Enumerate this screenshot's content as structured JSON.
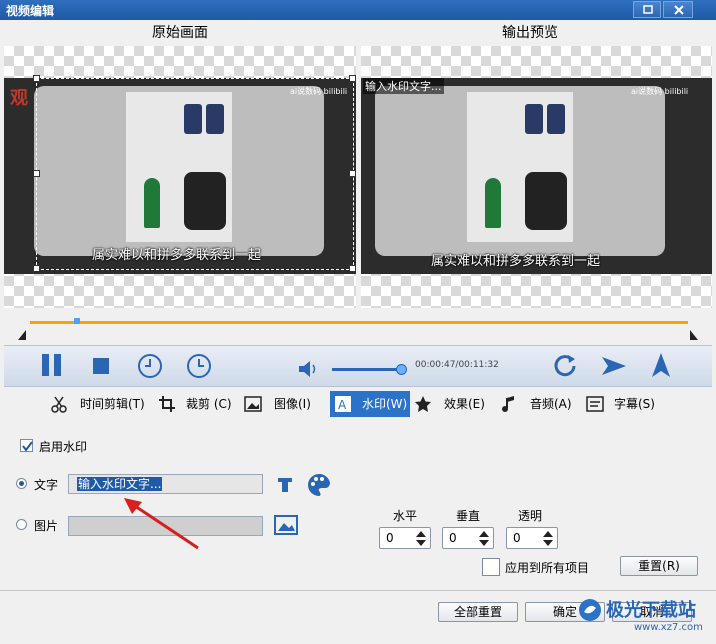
{
  "window": {
    "title": "视频编辑"
  },
  "panes": {
    "original_label": "原始画面",
    "preview_label": "输出预览"
  },
  "video": {
    "subtitle": "属实难以和拼多多联系到一起",
    "watermark_text": "输入水印文字...",
    "channel_logo": "ai说数码 bilibili",
    "corner_mark": "观"
  },
  "player": {
    "timecode": "00:00:47/00:11:32"
  },
  "tabs": [
    {
      "label": "时间剪辑(T)",
      "icon": "scissors-icon"
    },
    {
      "label": "裁剪 (C)",
      "icon": "crop-icon"
    },
    {
      "label": "图像(I)",
      "icon": "image-icon"
    },
    {
      "label": "水印(W)",
      "icon": "watermark-icon"
    },
    {
      "label": "效果(E)",
      "icon": "star-icon"
    },
    {
      "label": "音频(A)",
      "icon": "music-note-icon"
    },
    {
      "label": "字幕(S)",
      "icon": "subtitle-icon"
    }
  ],
  "watermark": {
    "enable_label": "启用水印",
    "enabled": true,
    "text_option_label": "文字",
    "text_value": "输入水印文字...",
    "image_option_label": "图片",
    "selected_mode": "text",
    "horizontal_label": "水平",
    "vertical_label": "垂直",
    "opacity_label": "透明",
    "horizontal_value": "0",
    "vertical_value": "0",
    "opacity_value": "0",
    "apply_all_label": "应用到所有项目",
    "reset_label": "重置(R)"
  },
  "footer": {
    "reset_all_label": "全部重置",
    "ok_label": "确定",
    "cancel_label": "取消"
  },
  "site_watermark": {
    "name": "极光下载站",
    "url": "www.xz7.com"
  },
  "colors": {
    "title_bar": "#1e5aa8",
    "active_tab": "#2a73c9",
    "timeline": "#f5a700",
    "annotation_arrow": "#d81e1e"
  }
}
